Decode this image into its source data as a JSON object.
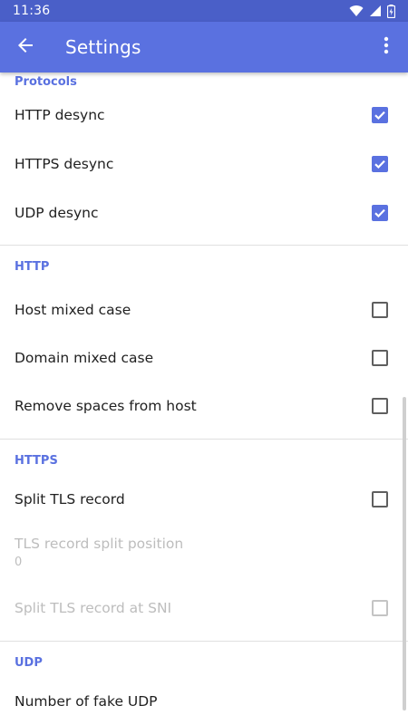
{
  "status_bar": {
    "time": "11:36"
  },
  "app_bar": {
    "title": "Settings"
  },
  "sections": {
    "protocols": {
      "header": "Protocols",
      "http_desync": {
        "label": "HTTP desync",
        "checked": true
      },
      "https_desync": {
        "label": "HTTPS desync",
        "checked": true
      },
      "udp_desync": {
        "label": "UDP desync",
        "checked": true
      }
    },
    "http": {
      "header": "HTTP",
      "host_mixed_case": {
        "label": "Host mixed case",
        "checked": false
      },
      "domain_mixed_case": {
        "label": "Domain mixed case",
        "checked": false
      },
      "remove_spaces": {
        "label": "Remove spaces from host",
        "checked": false
      }
    },
    "https": {
      "header": "HTTPS",
      "split_tls": {
        "label": "Split TLS record",
        "checked": false
      },
      "split_position": {
        "label": "TLS record split position",
        "value": "0"
      },
      "split_at_sni": {
        "label": "Split TLS record at SNI",
        "checked": false
      }
    },
    "udp": {
      "header": "UDP",
      "fake_udp": {
        "label": "Number of fake UDP"
      }
    }
  },
  "colors": {
    "primary": "#5a71e0",
    "status_bar": "#4a5fc8"
  },
  "icons": {
    "back": "arrow-back-icon",
    "menu": "more-vert-icon",
    "wifi": "wifi-icon",
    "signal": "signal-icon",
    "battery": "battery-icon"
  }
}
